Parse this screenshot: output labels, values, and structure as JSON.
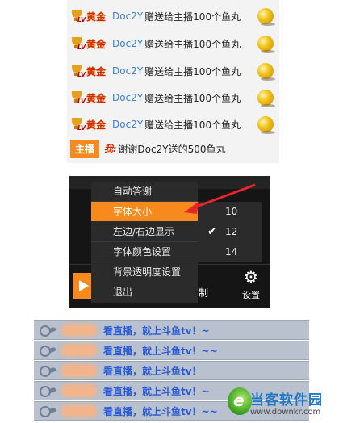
{
  "top_chat": {
    "messages": [
      {
        "badge": "LV",
        "rank": "黄金",
        "user": "Doc2Y",
        "text": "赠送给主播100个鱼丸"
      },
      {
        "badge": "LV",
        "rank": "黄金",
        "user": "Doc2Y",
        "text": "赠送给主播100个鱼丸"
      },
      {
        "badge": "LV",
        "rank": "黄金",
        "user": "Doc2Y",
        "text": "赠送给主播100个鱼丸"
      },
      {
        "badge": "LV",
        "rank": "黄金",
        "user": "Doc2Y",
        "text": "赠送给主播100个鱼丸"
      },
      {
        "badge": "LV",
        "rank": "黄金",
        "user": "Doc2Y",
        "text": "赠送给主播100个鱼丸"
      }
    ],
    "host_label": "主播",
    "host_me": "我:",
    "host_text": "谢谢Doc2Y送的500鱼丸"
  },
  "settings_panel": {
    "menu": [
      "自动答谢",
      "字体大小",
      "左边/右边显示",
      "字体颜色设置",
      "背景透明度设置",
      "退出"
    ],
    "active_index": 1,
    "font_sizes": [
      "10",
      "12",
      "14"
    ],
    "selected_size": "12",
    "partial_label": "制",
    "gear_label": "设置",
    "accent": "#f78a1d"
  },
  "bottom_chat": {
    "messages": [
      "看直播，就上斗鱼tv！~",
      "看直播，就上斗鱼tv！~~",
      "看直播，就上斗鱼tv！",
      "看直播，就上斗鱼tv！~",
      "看直播，就上斗鱼tv！~~"
    ]
  },
  "watermark": {
    "name": "当客软件园",
    "url": "www.downkr.com"
  }
}
